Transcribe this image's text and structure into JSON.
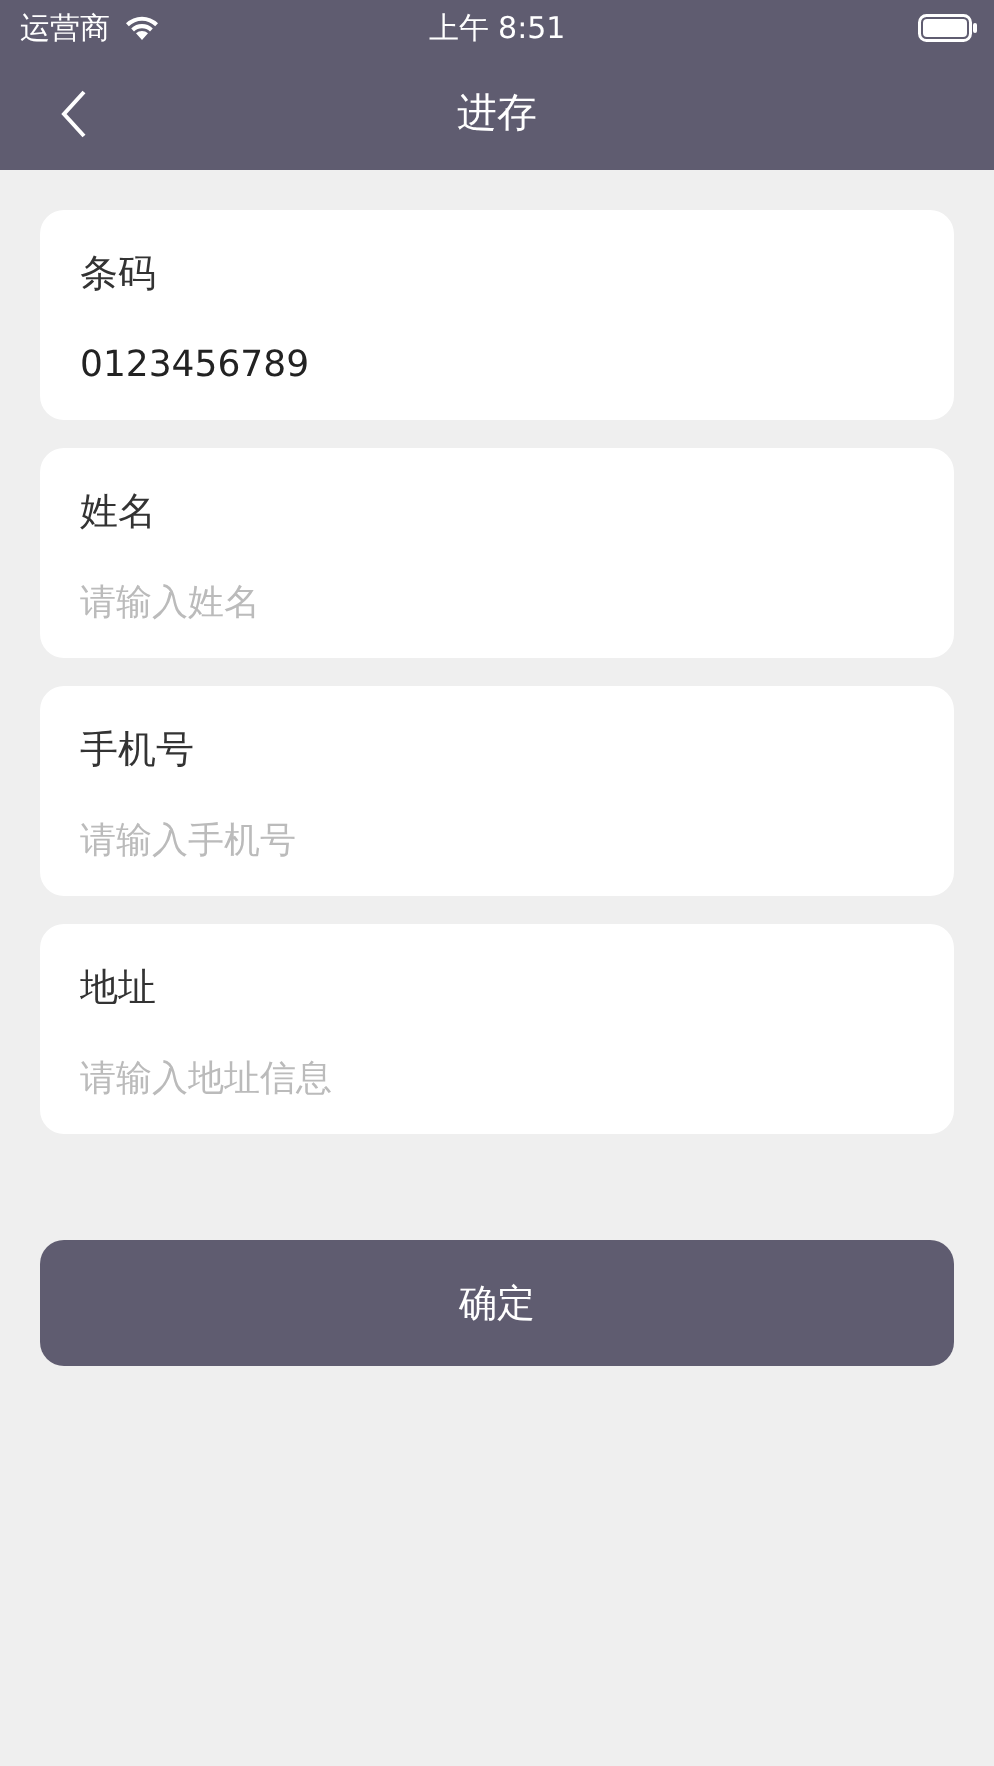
{
  "status_bar": {
    "carrier": "运营商",
    "time": "上午 8:51"
  },
  "nav": {
    "title": "进存"
  },
  "fields": [
    {
      "label": "条码",
      "value": "0123456789"
    },
    {
      "label": "姓名",
      "placeholder": "请输入姓名"
    },
    {
      "label": "手机号",
      "placeholder": "请输入手机号"
    },
    {
      "label": "地址",
      "placeholder": "请输入地址信息"
    }
  ],
  "button": {
    "label": "确定"
  }
}
